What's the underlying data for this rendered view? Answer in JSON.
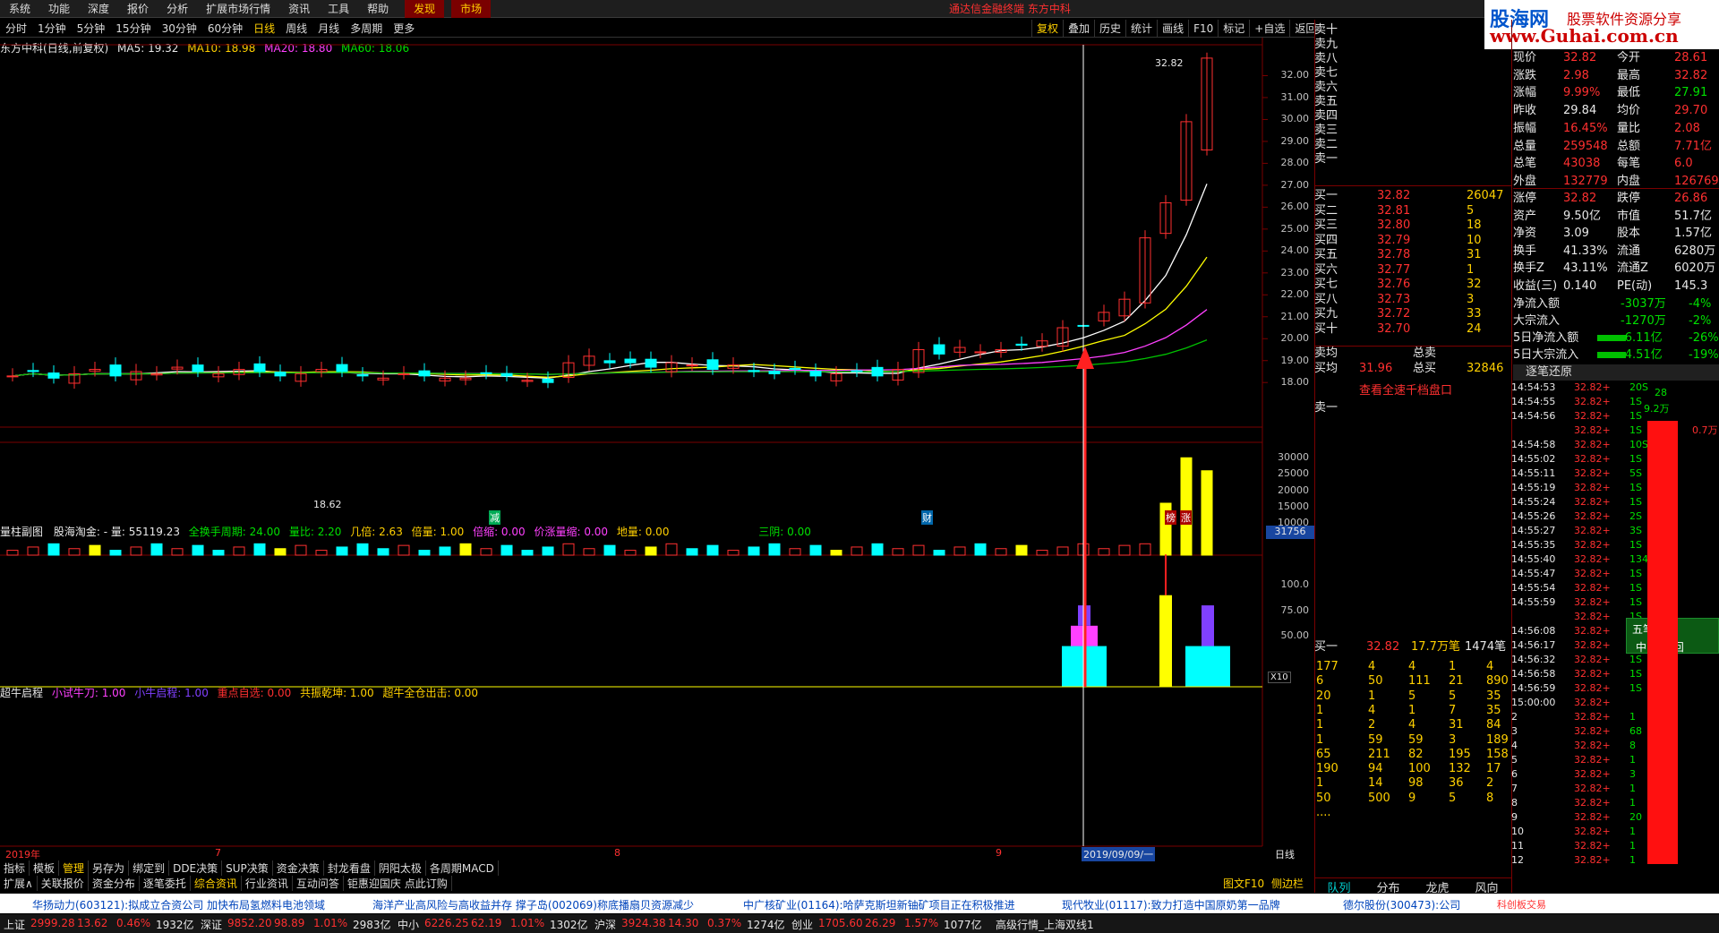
{
  "menu": {
    "items": [
      "系统",
      "功能",
      "深度",
      "报价",
      "分析",
      "扩展市场行情",
      "资讯",
      "工具",
      "帮助"
    ],
    "discover": "发现",
    "market": "市场",
    "title": "通达信金融终端 东方中科"
  },
  "brand": {
    "name": "股海网",
    "slogan": "股票软件资源分享",
    "url": "www.Guhai.com.cn"
  },
  "periods": [
    "分时",
    "1分钟",
    "5分钟",
    "15分钟",
    "30分钟",
    "60分钟",
    "日线",
    "周线",
    "月线",
    "多周期",
    "更多"
  ],
  "right_toolbar": [
    "复权",
    "叠加",
    "历史",
    "统计",
    "画线",
    "F10",
    "标记",
    "+自选",
    "返回"
  ],
  "stock": {
    "name": "东方中科",
    "desc": "(日线,前复权)"
  },
  "ma": {
    "ma5": "MA5: 19.32",
    "ma10": "MA10: 18.98",
    "ma20": "MA20: 18.80",
    "ma60": "MA60: 18.06"
  },
  "price_axis": [
    "32.00",
    "31.00",
    "30.00",
    "29.00",
    "28.00",
    "27.00",
    "26.00",
    "25.00",
    "24.00",
    "23.00",
    "22.00",
    "21.00",
    "20.00",
    "19.00",
    "18.00"
  ],
  "price_label_high": "32.82",
  "price_label_low": "18.62",
  "events": [
    "减",
    "财",
    "榜",
    "涨"
  ],
  "vol_header": {
    "title": "量柱副图",
    "f1": "股海淘金: - 量: 55119.23",
    "f2": "全换手周期: 24.00",
    "f3": "量比: 2.20",
    "f4": "几倍: 2.63",
    "f5": "倍量: 1.00",
    "f6": "倍缩: 0.00",
    "f7": "价涨量缩: 0.00",
    "f8": "地量: 0.00",
    "f9": "三阴: 0.00",
    "box": "31756"
  },
  "vol_axis": [
    "30000",
    "25000",
    "20000",
    "15000",
    "10000"
  ],
  "vol_unit": "X10",
  "bull_header": {
    "title": "超牛启程",
    "f1": "小试牛刀: 1.00",
    "f2": "小牛启程: 1.00",
    "f3": "重点自选: 0.00",
    "f4": "共振乾坤: 1.00",
    "f5": "超牛全仓出击: 0.00"
  },
  "bull_axis": [
    "100.0",
    "75.00",
    "50.00"
  ],
  "time_axis": {
    "year": "2019年",
    "m7": "7",
    "m8": "8",
    "m9": "9",
    "cursor": "2019/09/09/一",
    "period": "日线"
  },
  "bottom_tabs1": [
    "指标",
    "模板",
    "管理",
    "另存为",
    "绑定到",
    "DDE决策",
    "SUP决策",
    "资金决策",
    "封龙看盘",
    "阴阳太极",
    "各周期MACD"
  ],
  "bottom_tabs2": [
    "扩展∧",
    "关联报价",
    "资金分布",
    "逐笔委托",
    "综合资讯",
    "行业资讯",
    "互动问答",
    "钜惠迎国庆 点此订购"
  ],
  "bottom_right": {
    "f10": "图文F10",
    "side": "侧边栏"
  },
  "orderbook": {
    "sells": [
      [
        "卖十",
        "",
        ""
      ],
      [
        "卖九",
        "",
        ""
      ],
      [
        "卖八",
        "",
        ""
      ],
      [
        "卖七",
        "",
        ""
      ],
      [
        "卖六",
        "",
        ""
      ],
      [
        "卖五",
        "",
        ""
      ],
      [
        "卖四",
        "",
        ""
      ],
      [
        "卖三",
        "",
        ""
      ],
      [
        "卖二",
        "",
        ""
      ],
      [
        "卖一",
        "",
        ""
      ]
    ],
    "buys": [
      [
        "买一",
        "32.82",
        "26047"
      ],
      [
        "买二",
        "32.81",
        "5"
      ],
      [
        "买三",
        "32.80",
        "18"
      ],
      [
        "买四",
        "32.79",
        "10"
      ],
      [
        "买五",
        "32.78",
        "31"
      ],
      [
        "买六",
        "32.77",
        "1"
      ],
      [
        "买七",
        "32.76",
        "32"
      ],
      [
        "买八",
        "32.73",
        "3"
      ],
      [
        "买九",
        "32.72",
        "33"
      ],
      [
        "买十",
        "32.70",
        "24"
      ]
    ],
    "sell_avg": "卖均",
    "total_sell": "总卖",
    "buy_avg": "买均",
    "buy_avg_val": "31.96",
    "total_buy": "总买",
    "total_buy_val": "32846",
    "link": "查看全速千档盘口",
    "sell1_queue": "卖一",
    "buy1_queue": {
      "label": "买一",
      "price": "32.82",
      "vol": "17.7万笔",
      "count": "1474笔"
    },
    "queue": [
      [
        "177",
        "4",
        "4",
        "1",
        "4"
      ],
      [
        "6",
        "50",
        "111",
        "21",
        "890"
      ],
      [
        "20",
        "1",
        "5",
        "5",
        "35"
      ],
      [
        "1",
        "4",
        "1",
        "7",
        "35"
      ],
      [
        "1",
        "2",
        "4",
        "31",
        "84"
      ],
      [
        "1",
        "59",
        "59",
        "3",
        "189"
      ],
      [
        "65",
        "211",
        "82",
        "195",
        "158"
      ],
      [
        "190",
        "94",
        "100",
        "132",
        "17"
      ],
      [
        "1",
        "14",
        "98",
        "36",
        "2"
      ],
      [
        "50",
        "500",
        "9",
        "5",
        "8"
      ],
      [
        "....",
        "",
        "",
        "",
        ""
      ]
    ],
    "tabs": [
      "队列",
      "分布",
      "龙虎",
      "风向"
    ]
  },
  "quote": {
    "rows": [
      [
        "现价",
        "32.82",
        "今开",
        "28.61"
      ],
      [
        "涨跌",
        "2.98",
        "最高",
        "32.82"
      ],
      [
        "涨幅",
        "9.99%",
        "最低",
        "27.91"
      ],
      [
        "昨收",
        "29.84",
        "均价",
        "29.70"
      ],
      [
        "振幅",
        "16.45%",
        "量比",
        "2.08"
      ],
      [
        "总量",
        "259548",
        "总额",
        "7.71亿"
      ],
      [
        "总笔",
        "43038",
        "每笔",
        "6.0"
      ],
      [
        "外盘",
        "132779",
        "内盘",
        "126769"
      ],
      [
        "涨停",
        "32.82",
        "跌停",
        "26.86"
      ],
      [
        "资产",
        "9.50亿",
        "市值",
        "51.7亿"
      ],
      [
        "净资",
        "3.09",
        "股本",
        "1.57亿"
      ],
      [
        "换手",
        "41.33%",
        "流通",
        "6280万"
      ],
      [
        "换手Z",
        "43.11%",
        "流通Z",
        "6020万"
      ],
      [
        "收益(三)",
        "0.140",
        "PE(动)",
        "145.3"
      ]
    ],
    "flows": [
      [
        "净流入额",
        "-3037万",
        "-4%"
      ],
      [
        "大宗流入",
        "-1270万",
        "-2%"
      ],
      [
        "5日净流入额",
        "-6.11亿",
        "-26%"
      ],
      [
        "5日大宗流入",
        "-4.51亿",
        "-19%"
      ]
    ],
    "tick_title": "逐笔还原",
    "ticks": [
      [
        "14:54:53",
        "32.82+",
        "20S"
      ],
      [
        "14:54:55",
        "32.82+",
        "1S"
      ],
      [
        "14:54:56",
        "32.82+",
        "1S"
      ],
      [
        "",
        "32.82+",
        "1S"
      ],
      [
        "14:54:58",
        "32.82+",
        "10S"
      ],
      [
        "14:55:02",
        "32.82+",
        "1S"
      ],
      [
        "14:55:11",
        "32.82+",
        "5S"
      ],
      [
        "14:55:19",
        "32.82+",
        "1S"
      ],
      [
        "14:55:24",
        "32.82+",
        "1S"
      ],
      [
        "14:55:26",
        "32.82+",
        "2S"
      ],
      [
        "14:55:27",
        "32.82+",
        "3S"
      ],
      [
        "14:55:35",
        "32.82+",
        "1S"
      ],
      [
        "14:55:40",
        "32.82+",
        "134S"
      ],
      [
        "14:55:47",
        "32.82+",
        "1S"
      ],
      [
        "14:55:54",
        "32.82+",
        "1S"
      ],
      [
        "14:55:59",
        "32.82+",
        "1S"
      ],
      [
        "",
        "32.82+",
        "1S"
      ],
      [
        "14:56:08",
        "32.82+",
        "1S"
      ],
      [
        "14:56:17",
        "32.82+",
        "1S"
      ],
      [
        "14:56:32",
        "32.82+",
        "1S"
      ],
      [
        "14:56:58",
        "32.82+",
        "1S"
      ],
      [
        "14:56:59",
        "32.82+",
        "1S"
      ],
      [
        "15:00:00",
        "32.82+",
        ""
      ],
      [
        "2",
        "32.82+",
        "1"
      ],
      [
        "3",
        "32.82+",
        "68"
      ],
      [
        "4",
        "32.82+",
        "8"
      ],
      [
        "5",
        "32.82+",
        "1"
      ],
      [
        "6",
        "32.82+",
        "3"
      ],
      [
        "7",
        "32.82+",
        "1"
      ],
      [
        "8",
        "32.82+",
        "1"
      ],
      [
        "9",
        "32.82+",
        "20"
      ],
      [
        "10",
        "32.82+",
        "1"
      ],
      [
        "11",
        "32.82+",
        "1"
      ],
      [
        "12",
        "32.82+",
        "1"
      ]
    ],
    "bar_labels": [
      "28",
      "9.2万",
      "0.7万"
    ],
    "float": {
      "title": "五笔拼音",
      "icons": "中 ∮ 简 回"
    }
  },
  "news": [
    [
      "华扬动力(603121):拟成立合资公司 加快布局氢燃料电池领域",
      "#0044bb"
    ],
    [
      "海洋产业高风险与高收益并存 撑子岛(002069)称底播扇贝资源减少",
      "#0044bb"
    ],
    [
      "中广核矿业(01164):哈萨克斯坦新铀矿项目正在积极推进",
      "#0044bb"
    ],
    [
      "现代牧业(01117):致力打造中国原奶第一品牌",
      "#0044bb"
    ],
    [
      "德尔股份(300473):公司",
      "#0044bb"
    ]
  ],
  "news_brand": "科创板交易",
  "status": [
    [
      "上证",
      "2999.28",
      "13.62",
      "0.46%",
      "1932亿"
    ],
    [
      "深证",
      "9852.20",
      "98.89",
      "1.01%",
      "2983亿"
    ],
    [
      "中小",
      "6226.25",
      "62.19",
      "1.01%",
      "1302亿"
    ],
    [
      "沪深",
      "3924.38",
      "14.30",
      "0.37%",
      "1274亿"
    ],
    [
      "创业",
      "1705.60",
      "26.29",
      "1.57%",
      "1077亿"
    ]
  ],
  "status_tail": "高级行情_上海双线1",
  "colors": {
    "up": "#ff3030",
    "down": "#00ffff",
    "ma5": "#ffffff",
    "ma10": "#ffff00",
    "ma20": "#ff40ff",
    "ma60": "#00c000"
  },
  "chart_data": {
    "type": "candlestick",
    "title": "东方中科(日线,前复权)",
    "x": [
      "2019-06",
      "2019-07",
      "2019-08",
      "2019-09-09"
    ],
    "ohlc_last": [
      28.61,
      32.82,
      27.91,
      32.82
    ],
    "ylim": [
      17.5,
      33.0
    ],
    "volume_ylim": [
      0,
      32000
    ],
    "volume_last": 25955
  }
}
